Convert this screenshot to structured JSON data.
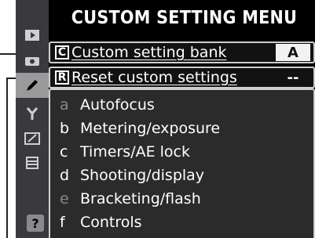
{
  "title": "CUSTOM SETTING MENU",
  "sidebar": {
    "tabs": [
      {
        "icon": "playback-icon",
        "glyph": "▶"
      },
      {
        "icon": "camera-icon",
        "glyph": "●"
      },
      {
        "icon": "pencil-icon",
        "glyph": "✎"
      },
      {
        "icon": "wrench-icon",
        "glyph": "Y"
      },
      {
        "icon": "retouch-icon",
        "glyph": "✐"
      },
      {
        "icon": "recent-settings-icon",
        "glyph": "☰"
      }
    ],
    "help": "?"
  },
  "rows": {
    "bank": {
      "letter": "C",
      "label": "Custom setting bank",
      "value": "A"
    },
    "reset": {
      "letter": "R",
      "label": "Reset custom settings",
      "value": "--"
    }
  },
  "items": [
    {
      "key": "a",
      "label": "Autofocus",
      "dim": true
    },
    {
      "key": "b",
      "label": "Metering/exposure",
      "dim": false
    },
    {
      "key": "c",
      "label": "Timers/AE lock",
      "dim": false
    },
    {
      "key": "d",
      "label": "Shooting/display",
      "dim": false
    },
    {
      "key": "e",
      "label": "Bracketing/flash",
      "dim": true
    },
    {
      "key": "f",
      "label": "Controls",
      "dim": false
    }
  ]
}
